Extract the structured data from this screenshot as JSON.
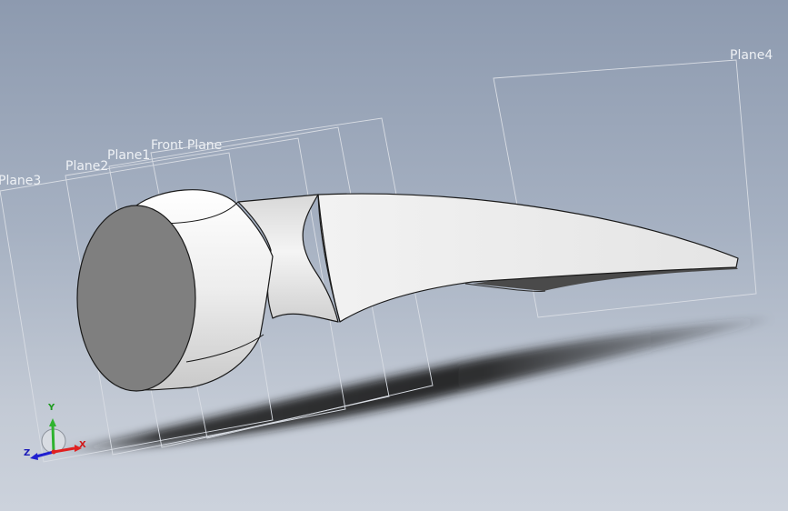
{
  "viewport": {
    "planes": [
      {
        "name": "Plane4"
      },
      {
        "name": "Front Plane"
      },
      {
        "name": "Plane1"
      },
      {
        "name": "Plane2"
      },
      {
        "name": "Plane3"
      }
    ],
    "triad": {
      "x_label": "X",
      "y_label": "Y",
      "z_label": "Z"
    },
    "colors": {
      "background_top": "#8d9aaf",
      "background_bottom": "#ccd2dc",
      "plane_outline": "#d9dde4",
      "model_face": "#ececec",
      "model_end_face": "#7f7f7f",
      "x_axis": "#e02020",
      "y_axis": "#2fb32f",
      "z_axis": "#2020d0"
    }
  }
}
